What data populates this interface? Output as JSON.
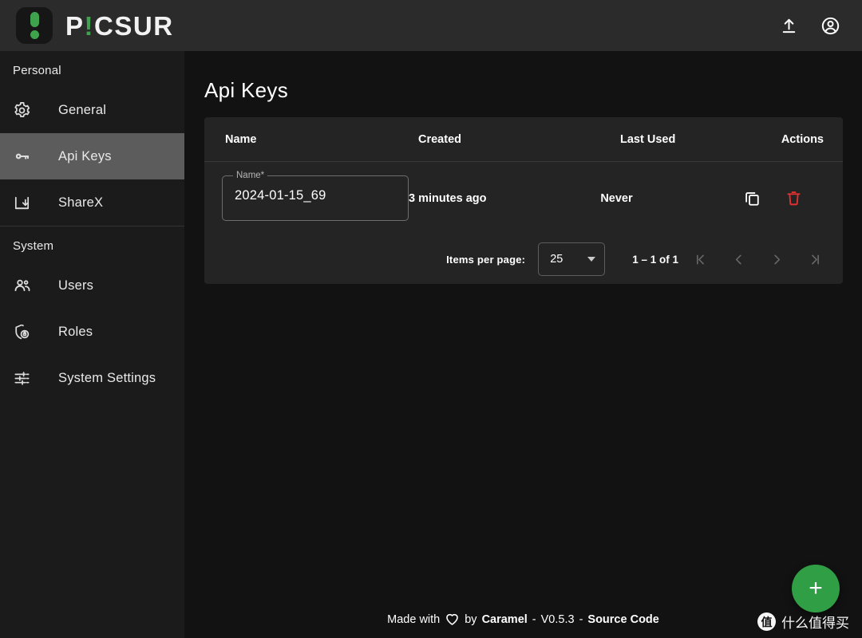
{
  "app": {
    "brand_name": "PICSUR",
    "brand_prefix": "P",
    "brand_accent": "!",
    "brand_suffix": "CSUR",
    "accent_color": "#3fa34d"
  },
  "toolbar": {
    "upload_icon": "upload-icon",
    "account_icon": "account-circle-icon"
  },
  "sidebar": {
    "sections": [
      {
        "title": "Personal",
        "items": [
          {
            "label": "General",
            "icon": "gear-icon",
            "active": false
          },
          {
            "label": "Api Keys",
            "icon": "key-icon",
            "active": true
          },
          {
            "label": "ShareX",
            "icon": "download-box-icon",
            "active": false
          }
        ]
      },
      {
        "title": "System",
        "items": [
          {
            "label": "Users",
            "icon": "users-icon",
            "active": false
          },
          {
            "label": "Roles",
            "icon": "shield-lock-icon",
            "active": false
          },
          {
            "label": "System Settings",
            "icon": "sliders-icon",
            "active": false
          }
        ]
      }
    ]
  },
  "main": {
    "title": "Api Keys",
    "table": {
      "columns": [
        "Name",
        "Created",
        "Last Used",
        "Actions"
      ],
      "rows": [
        {
          "name_field_label": "Name*",
          "name_value": "2024-01-15_69",
          "created": "3 minutes ago",
          "last_used": "Never",
          "actions": [
            {
              "name": "copy-icon",
              "color": "#ffffff"
            },
            {
              "name": "delete-icon",
              "color": "#e03131"
            }
          ]
        }
      ]
    },
    "paginator": {
      "items_per_page_label": "Items per page:",
      "items_per_page_value": "25",
      "range_label": "1 – 1 of 1",
      "buttons": [
        "first-page-icon",
        "previous-page-icon",
        "next-page-icon",
        "last-page-icon"
      ]
    },
    "fab_label": "+"
  },
  "footer": {
    "made_with": "Made with",
    "heart": "♡",
    "by": "by",
    "author": "Caramel",
    "sep1": "-",
    "version": "V0.5.3",
    "sep2": "-",
    "source_link": "Source Code"
  },
  "watermark": {
    "badge": "值",
    "text": "什么值得买"
  }
}
